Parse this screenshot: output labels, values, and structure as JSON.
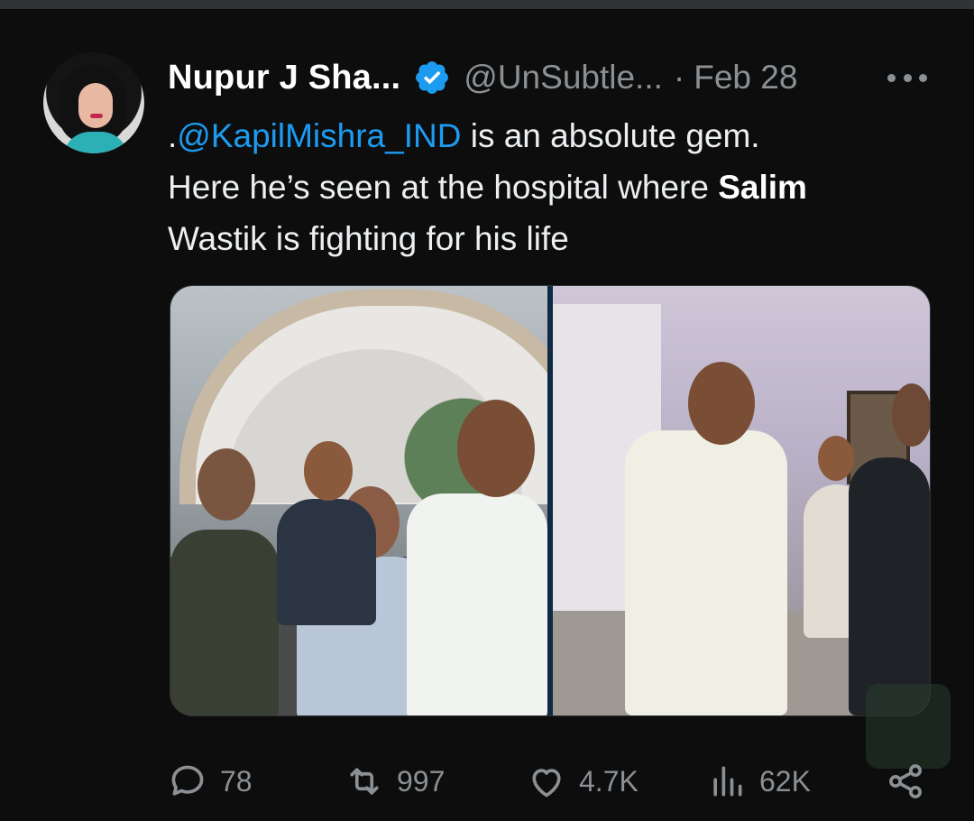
{
  "tweet": {
    "author_name": "Nupur J Sha...",
    "handle": "@UnSubtle...",
    "separator": "·",
    "date": "Feb 28",
    "text_line1_prefix": ".",
    "mention": "@KapilMishra_IND",
    "text_line1_suffix": " is an absolute gem.",
    "text_line2_prefix": "Here he’s seen at the hospital where ",
    "text_bold": "Salim",
    "text_line3": "Wastik is fighting for his life"
  },
  "actions": {
    "replies": "78",
    "reposts": "997",
    "likes": "4.7K",
    "views": "62K"
  },
  "colors": {
    "background": "#0d0d0d",
    "text": "#e7e9ea",
    "muted": "#8b9094",
    "link": "#1d9bf0",
    "verified": "#1d9bf0"
  },
  "icons": [
    "verified-badge-icon",
    "more-options-icon",
    "reply-icon",
    "repost-icon",
    "like-icon",
    "views-icon",
    "share-icon"
  ]
}
